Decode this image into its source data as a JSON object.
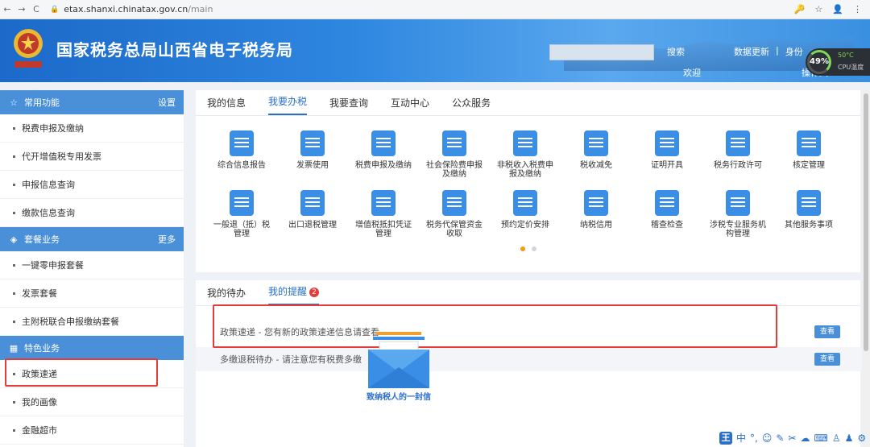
{
  "browser": {
    "back": "←",
    "forward": "→",
    "reload": "C",
    "url_host": "etax.shanxi.chinatax.gov.cn",
    "url_path": "/main"
  },
  "header": {
    "title": "国家税务总局山西省电子税务局",
    "search_label": "搜索",
    "link_update": "数据更新",
    "separator": "|",
    "link_identity": "身份",
    "welcome": "欢迎",
    "operator": "操作人"
  },
  "cpu_widget": {
    "percent": "49%",
    "temp": "50°C",
    "label": "CPU温度"
  },
  "sidebar": {
    "sections": [
      {
        "title": "常用功能",
        "action": "设置",
        "items": [
          "税费申报及缴纳",
          "代开增值税专用发票",
          "申报信息查询",
          "缴款信息查询"
        ]
      },
      {
        "title": "套餐业务",
        "action": "更多",
        "items": [
          "一键零申报套餐",
          "发票套餐",
          "主附税联合申报缴纳套餐"
        ]
      },
      {
        "title": "特色业务",
        "action": "",
        "items": [
          "政策速递",
          "我的画像",
          "金融超市"
        ]
      }
    ]
  },
  "main": {
    "tabs": [
      "我的信息",
      "我要办税",
      "我要查询",
      "互动中心",
      "公众服务"
    ],
    "active_tab": 1,
    "services": [
      {
        "label": "综合信息报告",
        "color": "#3a8ee6"
      },
      {
        "label": "发票使用",
        "color": "#3a8ee6"
      },
      {
        "label": "税费申报及缴纳",
        "color": "#3a8ee6"
      },
      {
        "label": "社会保险费申报及缴纳",
        "color": "#3a8ee6"
      },
      {
        "label": "非税收入税费申报及缴纳",
        "color": "#3a8ee6"
      },
      {
        "label": "税收减免",
        "color": "#3a8ee6"
      },
      {
        "label": "证明开具",
        "color": "#3a8ee6"
      },
      {
        "label": "税务行政许可",
        "color": "#3a8ee6"
      },
      {
        "label": "核定管理",
        "color": "#3a8ee6"
      },
      {
        "label": "一般退（抵）税管理",
        "color": "#3a8ee6"
      },
      {
        "label": "出口退税管理",
        "color": "#3a8ee6"
      },
      {
        "label": "增值税抵扣凭证管理",
        "color": "#3a8ee6"
      },
      {
        "label": "税务代保管资金收取",
        "color": "#3a8ee6"
      },
      {
        "label": "预约定价安排",
        "color": "#3a8ee6"
      },
      {
        "label": "纳税信用",
        "color": "#3a8ee6"
      },
      {
        "label": "稽查检查",
        "color": "#3a8ee6"
      },
      {
        "label": "涉税专业服务机构管理",
        "color": "#3a8ee6"
      },
      {
        "label": "其他服务事项",
        "color": "#3a8ee6"
      }
    ]
  },
  "todo": {
    "tabs": [
      "我的待办",
      "我的提醒"
    ],
    "reminder_count": "2",
    "messages": [
      {
        "text": "政策速递 - 您有新的政策速递信息请查看",
        "button": "查看"
      },
      {
        "text": "多缴退税待办 - 请注意您有税费多缴",
        "button": "查看"
      }
    ],
    "envelope_caption": "致纳税人的一封信"
  },
  "ime": {
    "logo": "王",
    "mode": "中"
  },
  "colors": {
    "accent": "#2a70c9",
    "sidebar_head": "#4a90d9",
    "highlight": "#e43b3b"
  }
}
